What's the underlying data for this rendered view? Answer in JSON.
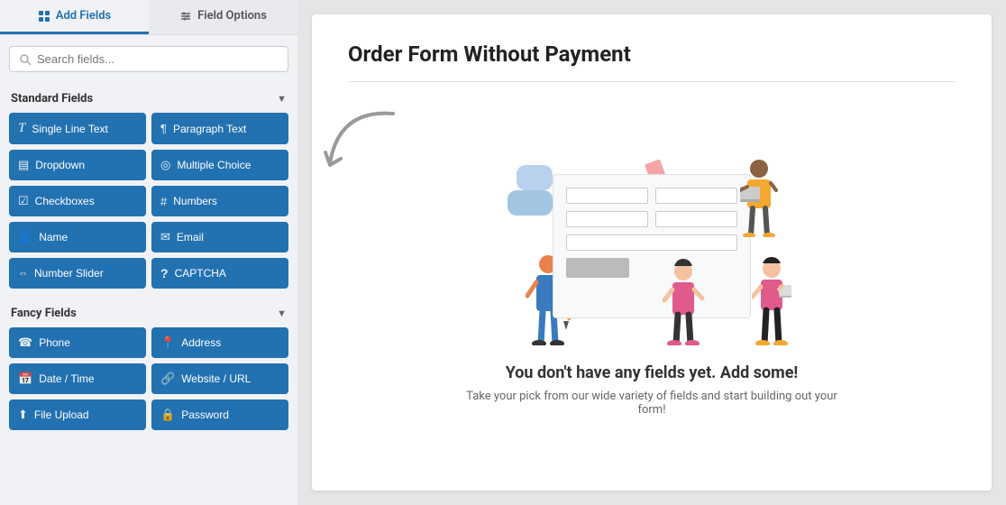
{
  "tabs": {
    "add_fields": {
      "label": "Add Fields",
      "icon": "grid-icon",
      "active": true
    },
    "field_options": {
      "label": "Field Options",
      "icon": "sliders-icon",
      "active": false
    }
  },
  "search": {
    "placeholder": "Search fields..."
  },
  "standard_fields": {
    "section_label": "Standard Fields",
    "fields": [
      {
        "label": "Single Line Text",
        "icon": "T"
      },
      {
        "label": "Paragraph Text",
        "icon": "¶"
      },
      {
        "label": "Dropdown",
        "icon": "▤"
      },
      {
        "label": "Multiple Choice",
        "icon": "◎"
      },
      {
        "label": "Checkboxes",
        "icon": "☑"
      },
      {
        "label": "Numbers",
        "icon": "#"
      },
      {
        "label": "Name",
        "icon": "👤"
      },
      {
        "label": "Email",
        "icon": "✉"
      },
      {
        "label": "Number Slider",
        "icon": "⇔"
      },
      {
        "label": "CAPTCHA",
        "icon": "?"
      }
    ]
  },
  "fancy_fields": {
    "section_label": "Fancy Fields",
    "fields": [
      {
        "label": "Phone",
        "icon": "☎"
      },
      {
        "label": "Address",
        "icon": "📍"
      },
      {
        "label": "Date / Time",
        "icon": "📅"
      },
      {
        "label": "Website / URL",
        "icon": "🔗"
      },
      {
        "label": "File Upload",
        "icon": "⬆"
      },
      {
        "label": "Password",
        "icon": "🔒"
      }
    ]
  },
  "form": {
    "title": "Order Form Without Payment"
  },
  "empty_state": {
    "title": "You don't have any fields yet. Add some!",
    "subtitle": "Take your pick from our wide variety of fields and start building out your form!"
  },
  "collapse_handle": "<"
}
